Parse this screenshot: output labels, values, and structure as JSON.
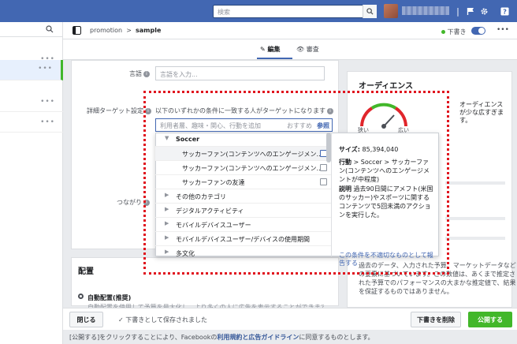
{
  "topbar": {
    "search_placeholder": "検索"
  },
  "breadcrumb": {
    "campaign": "promotion",
    "separator": ">",
    "adset": "sample"
  },
  "header": {
    "draft_label": "下書き"
  },
  "tabs": [
    {
      "label": "編集"
    },
    {
      "label": "審査"
    }
  ],
  "form": {
    "language_label": "言語",
    "language_placeholder": "言語を入力...",
    "detail_target_label": "詳細ターゲット設定",
    "detail_target_desc": "以下のいずれかの条件に一致する人がターゲットになります",
    "detail_placeholder": "利用者層、趣味・関心、行動を追加",
    "suggest_label": "おすすめ",
    "browse_label": "参照",
    "connection_label": "つながり"
  },
  "dropdown": {
    "items": [
      {
        "kind": "cat",
        "label": "Soccer",
        "open": true
      },
      {
        "kind": "sub",
        "label": "サッカーファン(コンテンツへのエンゲージメン…",
        "selected": true
      },
      {
        "kind": "sub",
        "label": "サッカーファン(コンテンツへのエンゲージメン…"
      },
      {
        "kind": "sub",
        "label": "サッカーファンの友達"
      },
      {
        "kind": "cat",
        "label": "その他のカテゴリ"
      },
      {
        "kind": "cat",
        "label": "デジタルアクティビティ"
      },
      {
        "kind": "cat",
        "label": "モバイルデバイスユーザー"
      },
      {
        "kind": "cat",
        "label": "モバイルデバイスユーザー/デバイスの使用期間"
      },
      {
        "kind": "cat",
        "label": "多文化"
      }
    ],
    "detail": {
      "size_label": "サイズ:",
      "size_value": "85,394,040",
      "behavior_label": "行動",
      "behavior_value": "> Soccer > サッカーファン(コンテンツへのエンゲージメントが中程度)",
      "desc_label": "説明",
      "desc_value": "過去90日間にアメフト(米国のサッカー)やスポーツに関するコンテンツで5回未満のアクションを実行した。",
      "report_link": "この条件を不適切なものとして報告する"
    }
  },
  "placement": {
    "title": "配置",
    "auto_label": "自動配置(推奨)",
    "hint": "自動配置を使用して予算を最大化し、より多くの人に広告を表示することができます。"
  },
  "audience": {
    "title": "オーディエンス",
    "status": "オーディエンスが少な広すぎます。",
    "gauge_low": "狭い",
    "gauge_high": "広い",
    "note": "過去のデータ、入力された予算、マーケットデータなどの要素に基づいています。この数値は、あくまで推定された予算でのパフォーマンスの大まかな推定値で、結果を保証するものではありません。"
  },
  "bottombar": {
    "close": "閉じる",
    "saved": "下書きとして保存されました",
    "delete_draft": "下書きを削除",
    "publish": "公開する"
  },
  "footer": {
    "prefix": "[公開する]をクリックすることにより、Facebookの",
    "link": "利用規約と広告ガイドライン",
    "suffix": "に同意するものとします。"
  },
  "colors": {
    "brand": "#4267b2",
    "publish": "#42b72a",
    "highlight": "#e0141e"
  }
}
